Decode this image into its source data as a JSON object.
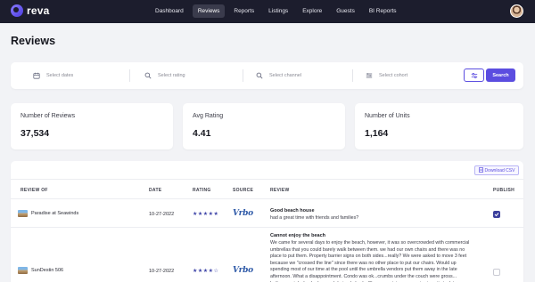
{
  "app": {
    "name": "reva"
  },
  "nav": {
    "items": [
      {
        "label": "Dashboard",
        "active": false
      },
      {
        "label": "Reviews",
        "active": true
      },
      {
        "label": "Reports",
        "active": false
      },
      {
        "label": "Listings",
        "active": false
      },
      {
        "label": "Explore",
        "active": false
      },
      {
        "label": "Guests",
        "active": false
      },
      {
        "label": "BI Reports",
        "active": false
      }
    ]
  },
  "page": {
    "title": "Reviews"
  },
  "filters": {
    "dates_placeholder": "Select dates",
    "rating_placeholder": "Select rating",
    "channel_placeholder": "Select channel",
    "cohort_placeholder": "Select cohort",
    "search_label": "Search"
  },
  "stats": [
    {
      "label": "Number of Reviews",
      "value": "37,534"
    },
    {
      "label": "Avg Rating",
      "value": "4.41"
    },
    {
      "label": "Number of Units",
      "value": "1,164"
    }
  ],
  "table": {
    "download_label": "Download CSV",
    "headers": {
      "review_of": "REVIEW OF",
      "date": "DATE",
      "rating": "RATING",
      "source": "SOURCE",
      "review": "REVIEW",
      "publish": "PUBLISH"
    },
    "rows": [
      {
        "property": "Paradise at Seawinds",
        "date": "10-27-2022",
        "rating_stars": "★★★★★",
        "rating": 5,
        "source": "Vrbo",
        "review_title": "Good beach house",
        "review_text": "had a great time with friends and families?",
        "published": true
      },
      {
        "property": "SunDestin 506",
        "date": "10-27-2022",
        "rating_stars": "★★★★☆",
        "rating": 4,
        "source": "Vrbo",
        "review_title": "Cannot enjoy the beach",
        "review_text": "We came for several days to enjoy the beach, however, it was so overcrowded with commercial umbrellas that you could barely walk between them. we had our own chairs and there was no place to put them. Property barrier signs on both sides...really? We were asked to move 3 feet because we \"crossed the line\" since there was no other place to put our chairs. Would up spending most of our time at the pool until the umbrella vendors put them away in the late afternoon. What a disappointment. Condo was ok...crumbs under the couch were gross... bathroom sinks backed up and drained slowly. Shower curtain was a pain since it stuck to you",
        "published": false
      }
    ]
  },
  "colors": {
    "topbar": "#1c1d2d",
    "accent": "#5b4de0",
    "background": "#f2f3f6"
  }
}
